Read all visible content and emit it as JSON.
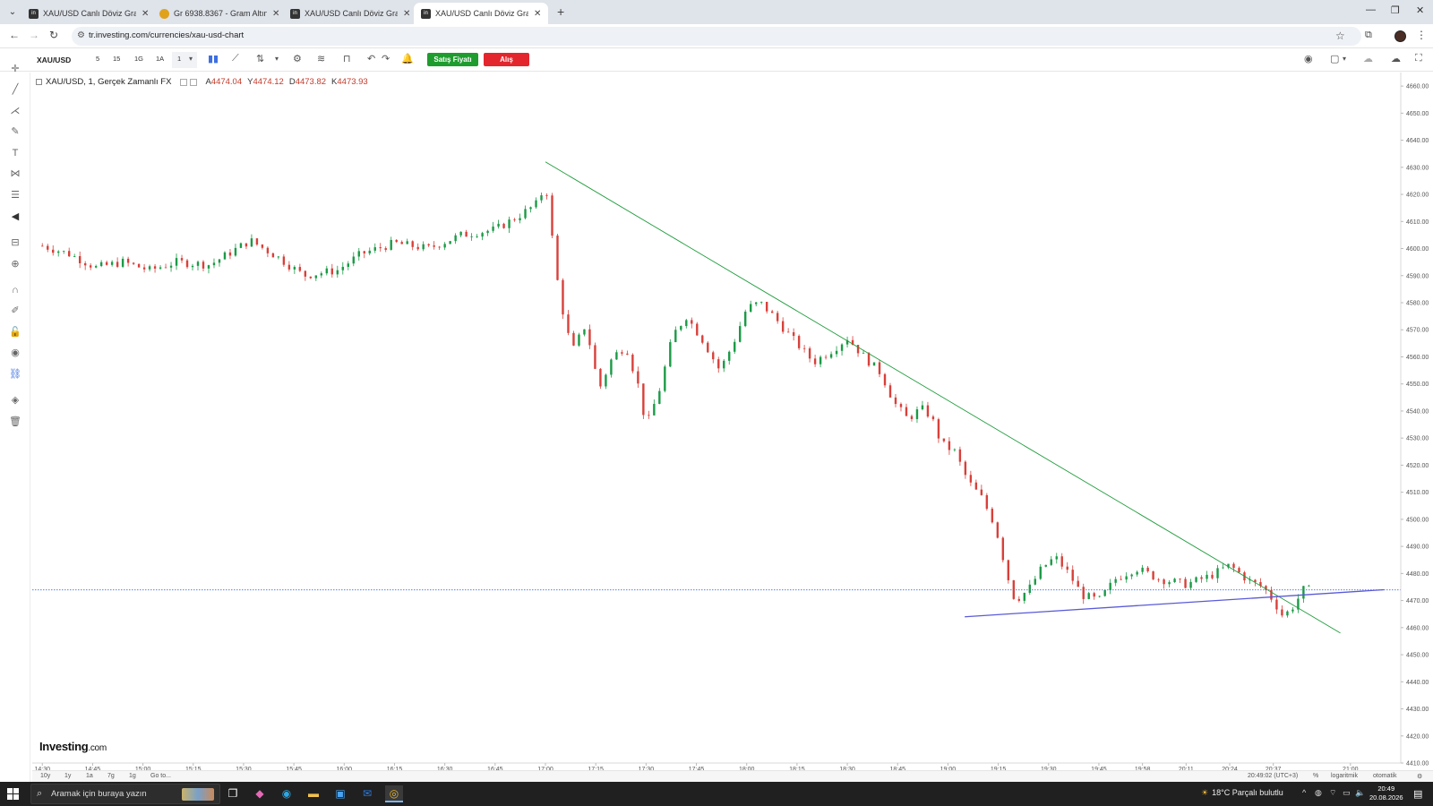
{
  "browser": {
    "tabs": [
      {
        "label": "XAU/USD Canlı Döviz Grafik - In",
        "active": false,
        "favicon": "investing"
      },
      {
        "label": "Gr 6938.8367 - Gram Altın'ın fiy",
        "active": false,
        "favicon": "coin"
      },
      {
        "label": "XAU/USD Canlı Döviz Grafik - In",
        "active": false,
        "favicon": "investing"
      },
      {
        "label": "XAU/USD Canlı Döviz Grafik - In",
        "active": true,
        "favicon": "investing"
      }
    ],
    "url": "tr.investing.com/currencies/xau-usd-chart"
  },
  "toolbar": {
    "symbol": "XAU/USD",
    "intervals": [
      "5",
      "15",
      "1G",
      "1A",
      "1"
    ],
    "sell_label": "Satış Fiyatı",
    "buy_label": "Alış"
  },
  "legend": {
    "title": "XAU/USD, 1, Gerçek Zamanlı FX",
    "values": [
      {
        "key": "A",
        "value": "4474.04"
      },
      {
        "key": "Y",
        "value": "4474.12"
      },
      {
        "key": "D",
        "value": "4473.82"
      },
      {
        "key": "K",
        "value": "4473.93"
      }
    ]
  },
  "chart_data": {
    "type": "candlestick",
    "symbol": "XAU/USD",
    "interval": "1",
    "last_price": "4473.93",
    "ylim": [
      4410,
      4665
    ],
    "y_ticks": [
      "4660.00",
      "4650.00",
      "4640.00",
      "4630.00",
      "4620.00",
      "4610.00",
      "4600.00",
      "4590.00",
      "4580.00",
      "4570.00",
      "4560.00",
      "4550.00",
      "4540.00",
      "4530.00",
      "4520.00",
      "4510.00",
      "4500.00",
      "4490.00",
      "4480.00",
      "4470.00",
      "4460.00",
      "4450.00",
      "4440.00",
      "4430.00",
      "4420.00",
      "4410.00"
    ],
    "x_ticks": [
      "14:30",
      "14:45",
      "15:00",
      "15:15",
      "15:30",
      "15:45",
      "16:00",
      "16:15",
      "16:30",
      "16:45",
      "17:00",
      "17:15",
      "17:30",
      "17:45",
      "18:00",
      "18:15",
      "18:30",
      "18:45",
      "19:00",
      "19:15",
      "19:30",
      "19:45",
      "19:58",
      "20:11",
      "20:24",
      "20:37",
      "21:00"
    ],
    "path": [
      {
        "t": "14:30",
        "price": 4601
      },
      {
        "t": "14:38",
        "price": 4598
      },
      {
        "t": "14:46",
        "price": 4593
      },
      {
        "t": "14:54",
        "price": 4595
      },
      {
        "t": "15:02",
        "price": 4592
      },
      {
        "t": "15:10",
        "price": 4595
      },
      {
        "t": "15:20",
        "price": 4594
      },
      {
        "t": "15:32",
        "price": 4603
      },
      {
        "t": "15:40",
        "price": 4597
      },
      {
        "t": "15:48",
        "price": 4590
      },
      {
        "t": "15:58",
        "price": 4592
      },
      {
        "t": "16:05",
        "price": 4598
      },
      {
        "t": "16:15",
        "price": 4602
      },
      {
        "t": "16:25",
        "price": 4600
      },
      {
        "t": "16:35",
        "price": 4605
      },
      {
        "t": "16:45",
        "price": 4607
      },
      {
        "t": "16:52",
        "price": 4612
      },
      {
        "t": "16:58",
        "price": 4617
      },
      {
        "t": "17:00",
        "price": 4625
      },
      {
        "t": "17:02",
        "price": 4604
      },
      {
        "t": "17:04",
        "price": 4584
      },
      {
        "t": "17:06",
        "price": 4572
      },
      {
        "t": "17:08",
        "price": 4562
      },
      {
        "t": "17:12",
        "price": 4572
      },
      {
        "t": "17:16",
        "price": 4548
      },
      {
        "t": "17:20",
        "price": 4560
      },
      {
        "t": "17:24",
        "price": 4564
      },
      {
        "t": "17:28",
        "price": 4548
      },
      {
        "t": "17:30",
        "price": 4534
      },
      {
        "t": "17:34",
        "price": 4548
      },
      {
        "t": "17:38",
        "price": 4568
      },
      {
        "t": "17:42",
        "price": 4575
      },
      {
        "t": "17:47",
        "price": 4566
      },
      {
        "t": "17:52",
        "price": 4555
      },
      {
        "t": "17:56",
        "price": 4565
      },
      {
        "t": "18:00",
        "price": 4578
      },
      {
        "t": "18:04",
        "price": 4580
      },
      {
        "t": "18:08",
        "price": 4575
      },
      {
        "t": "18:12",
        "price": 4569
      },
      {
        "t": "18:20",
        "price": 4558
      },
      {
        "t": "18:26",
        "price": 4563
      },
      {
        "t": "18:30",
        "price": 4567
      },
      {
        "t": "18:35",
        "price": 4560
      },
      {
        "t": "18:40",
        "price": 4554
      },
      {
        "t": "18:44",
        "price": 4543
      },
      {
        "t": "18:48",
        "price": 4537
      },
      {
        "t": "18:52",
        "price": 4541
      },
      {
        "t": "18:55",
        "price": 4538
      },
      {
        "t": "18:58",
        "price": 4528
      },
      {
        "t": "19:02",
        "price": 4525
      },
      {
        "t": "19:06",
        "price": 4514
      },
      {
        "t": "19:10",
        "price": 4508
      },
      {
        "t": "19:14",
        "price": 4498
      },
      {
        "t": "19:18",
        "price": 4478
      },
      {
        "t": "19:20",
        "price": 4470
      },
      {
        "t": "19:24",
        "price": 4474
      },
      {
        "t": "19:28",
        "price": 4482
      },
      {
        "t": "19:32",
        "price": 4486
      },
      {
        "t": "19:36",
        "price": 4480
      },
      {
        "t": "19:40",
        "price": 4472
      },
      {
        "t": "19:45",
        "price": 4470
      },
      {
        "t": "19:50",
        "price": 4478
      },
      {
        "t": "19:56",
        "price": 4482
      },
      {
        "t": "20:03",
        "price": 4478
      },
      {
        "t": "20:11",
        "price": 4476
      },
      {
        "t": "20:18",
        "price": 4479
      },
      {
        "t": "20:24",
        "price": 4483
      },
      {
        "t": "20:30",
        "price": 4477
      },
      {
        "t": "20:34",
        "price": 4475
      },
      {
        "t": "20:37",
        "price": 4470
      },
      {
        "t": "20:40",
        "price": 4464
      },
      {
        "t": "20:43",
        "price": 4468
      },
      {
        "t": "20:46",
        "price": 4474
      },
      {
        "t": "20:49",
        "price": 4474
      }
    ],
    "trendlines": [
      {
        "color": "#1f9c3c",
        "from": {
          "t": "17:00",
          "price": 4632
        },
        "to": {
          "t": "20:57",
          "price": 4458
        }
      },
      {
        "color": "#5a5ad8",
        "from": {
          "t": "19:05",
          "price": 4464
        },
        "to": {
          "t": "21:10",
          "price": 4474
        }
      }
    ],
    "horizontal_line": {
      "price": 4473.93,
      "color": "#3d6fe0"
    }
  },
  "logo": {
    "brand": "Investing",
    "suffix": ".com"
  },
  "rangebar": {
    "buttons": [
      "10y",
      "1y",
      "1a",
      "7g",
      "1g",
      "Go to..."
    ],
    "right": [
      "20:49:02 (UTC+3)",
      "%",
      "logaritmik",
      "otomatik"
    ]
  },
  "taskbar": {
    "search_placeholder": "Aramak için buraya yazın",
    "weather": "18°C  Parçalı bulutlu",
    "time": "20:49",
    "date": "20.08.2026"
  }
}
